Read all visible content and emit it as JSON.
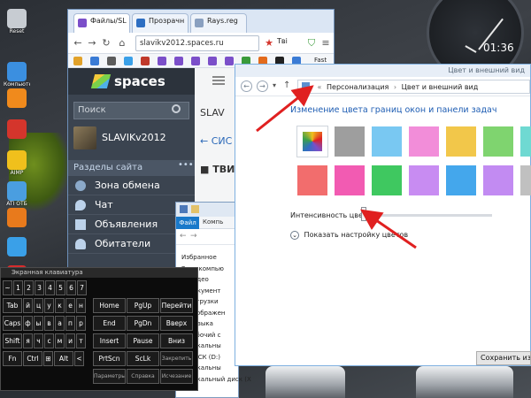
{
  "clock": {
    "time": "01:36"
  },
  "desktop": {
    "icons": [
      {
        "name": "recycle-bin",
        "label": "Reset",
        "color": "#c7ccd2"
      },
      {
        "name": "computer",
        "label": "Компьютер",
        "color": "#3b8fe0"
      },
      {
        "name": "vlc",
        "label": "",
        "color": "#f08a1c"
      },
      {
        "name": "app-red",
        "label": "",
        "color": "#d4352c"
      },
      {
        "name": "aimp",
        "label": "AIMP",
        "color": "#f0c01c"
      },
      {
        "name": "folder",
        "label": "ATI ОТБ",
        "color": "#4a9ee0"
      },
      {
        "name": "firefox",
        "label": "",
        "color": "#e87a1c"
      },
      {
        "name": "windows",
        "label": "",
        "color": "#3aa0e8"
      },
      {
        "name": "zotero",
        "label": "",
        "color": "#d82c2c"
      }
    ]
  },
  "browser": {
    "tabs": [
      {
        "label": "Файлы/SL",
        "icon_color": "#7b4fc9",
        "active": true
      },
      {
        "label": "Прозрачн",
        "icon_color": "#2e6fc2",
        "active": false
      },
      {
        "label": "Rays.reg",
        "icon_color": "#8aa0c0",
        "active": false
      }
    ],
    "url": "slavikv2012.spaces.ru",
    "translate_label": "Тві",
    "bookmark_text": "Fast",
    "spaces": {
      "brand": "spaces",
      "search_placeholder": "Поиск",
      "username": "SLAVIKv2012",
      "section_title": "Разделы сайта",
      "section_more": "•••",
      "menu": [
        {
          "label": "Зона обмена",
          "icon": "exchange-icon"
        },
        {
          "label": "Чат",
          "icon": "chat-icon"
        },
        {
          "label": "Объявления",
          "icon": "ads-icon"
        },
        {
          "label": "Обитатели",
          "icon": "people-icon"
        }
      ],
      "main_lines": [
        "SLAV",
        "← СИС",
        "■ ТВИ"
      ]
    }
  },
  "explorer": {
    "file_tab": "Файл",
    "computer_tab": "Компь",
    "items": [
      "Избранное",
      "Этот компью",
      "Видео",
      "Документ",
      "Загрузки",
      "Изображен",
      "Музыка",
      "Рабочий с",
      "Локальны",
      "ДИСК (D:)",
      "Локальны",
      "Локальный диск (X"
    ]
  },
  "keyboard": {
    "title": "Экранная клавиатура",
    "rows": [
      [
        "~",
        "1",
        "2",
        "3",
        "4",
        "5",
        "6",
        "7",
        "8",
        "9",
        "0",
        "-",
        "=",
        "⌫"
      ],
      [
        "Tab",
        "й",
        "ц",
        "у",
        "к",
        "е",
        "н",
        "г",
        "ш",
        "щ",
        "з",
        "х",
        "ъ",
        "\\"
      ],
      [
        "Caps",
        "ф",
        "ы",
        "в",
        "а",
        "п",
        "р",
        "о",
        "л",
        "д",
        "ж",
        "э",
        "Enter"
      ],
      [
        "Shift",
        "я",
        "ч",
        "с",
        "м",
        "и",
        "т",
        "ь",
        "б",
        "ю",
        ".",
        "Shift"
      ],
      [
        "Fn",
        "Ctrl",
        "⊞",
        "Alt",
        "",
        "Alt",
        "Ctrl",
        "<",
        ">"
      ]
    ],
    "nav": [
      [
        "Home",
        "PgUp",
        "Перейти"
      ],
      [
        "End",
        "PgDn",
        "Вверх"
      ],
      [
        "Insert",
        "Pause",
        "Вниз"
      ],
      [
        "PrtScn",
        "ScLk",
        "Закрепить"
      ],
      [
        "Параметры",
        "Справка",
        "Исчезание"
      ]
    ]
  },
  "color_window": {
    "title": "Цвет и внешний вид",
    "breadcrumb": [
      "«",
      "Персонализация",
      "›",
      "Цвет и внешний вид"
    ],
    "heading": "Изменение цвета границ окон и панели задач",
    "swatches": [
      [
        "#ffffff",
        "#9e9e9e",
        "#79c8f2",
        "#f28dd9",
        "#f2c74a",
        "#7fd46f",
        "#6fd9d2"
      ],
      [
        "#f26d6d",
        "#f25bb2",
        "#3fc860",
        "#c88cf2",
        "#44a7ec",
        "#c28bf2",
        "#c0c0c0"
      ]
    ],
    "intensity_label": "Интенсивность цвета:",
    "intensity_level": 0.02,
    "show_mixer": "Показать настройку цветов",
    "save_button": "Сохранить измене"
  }
}
